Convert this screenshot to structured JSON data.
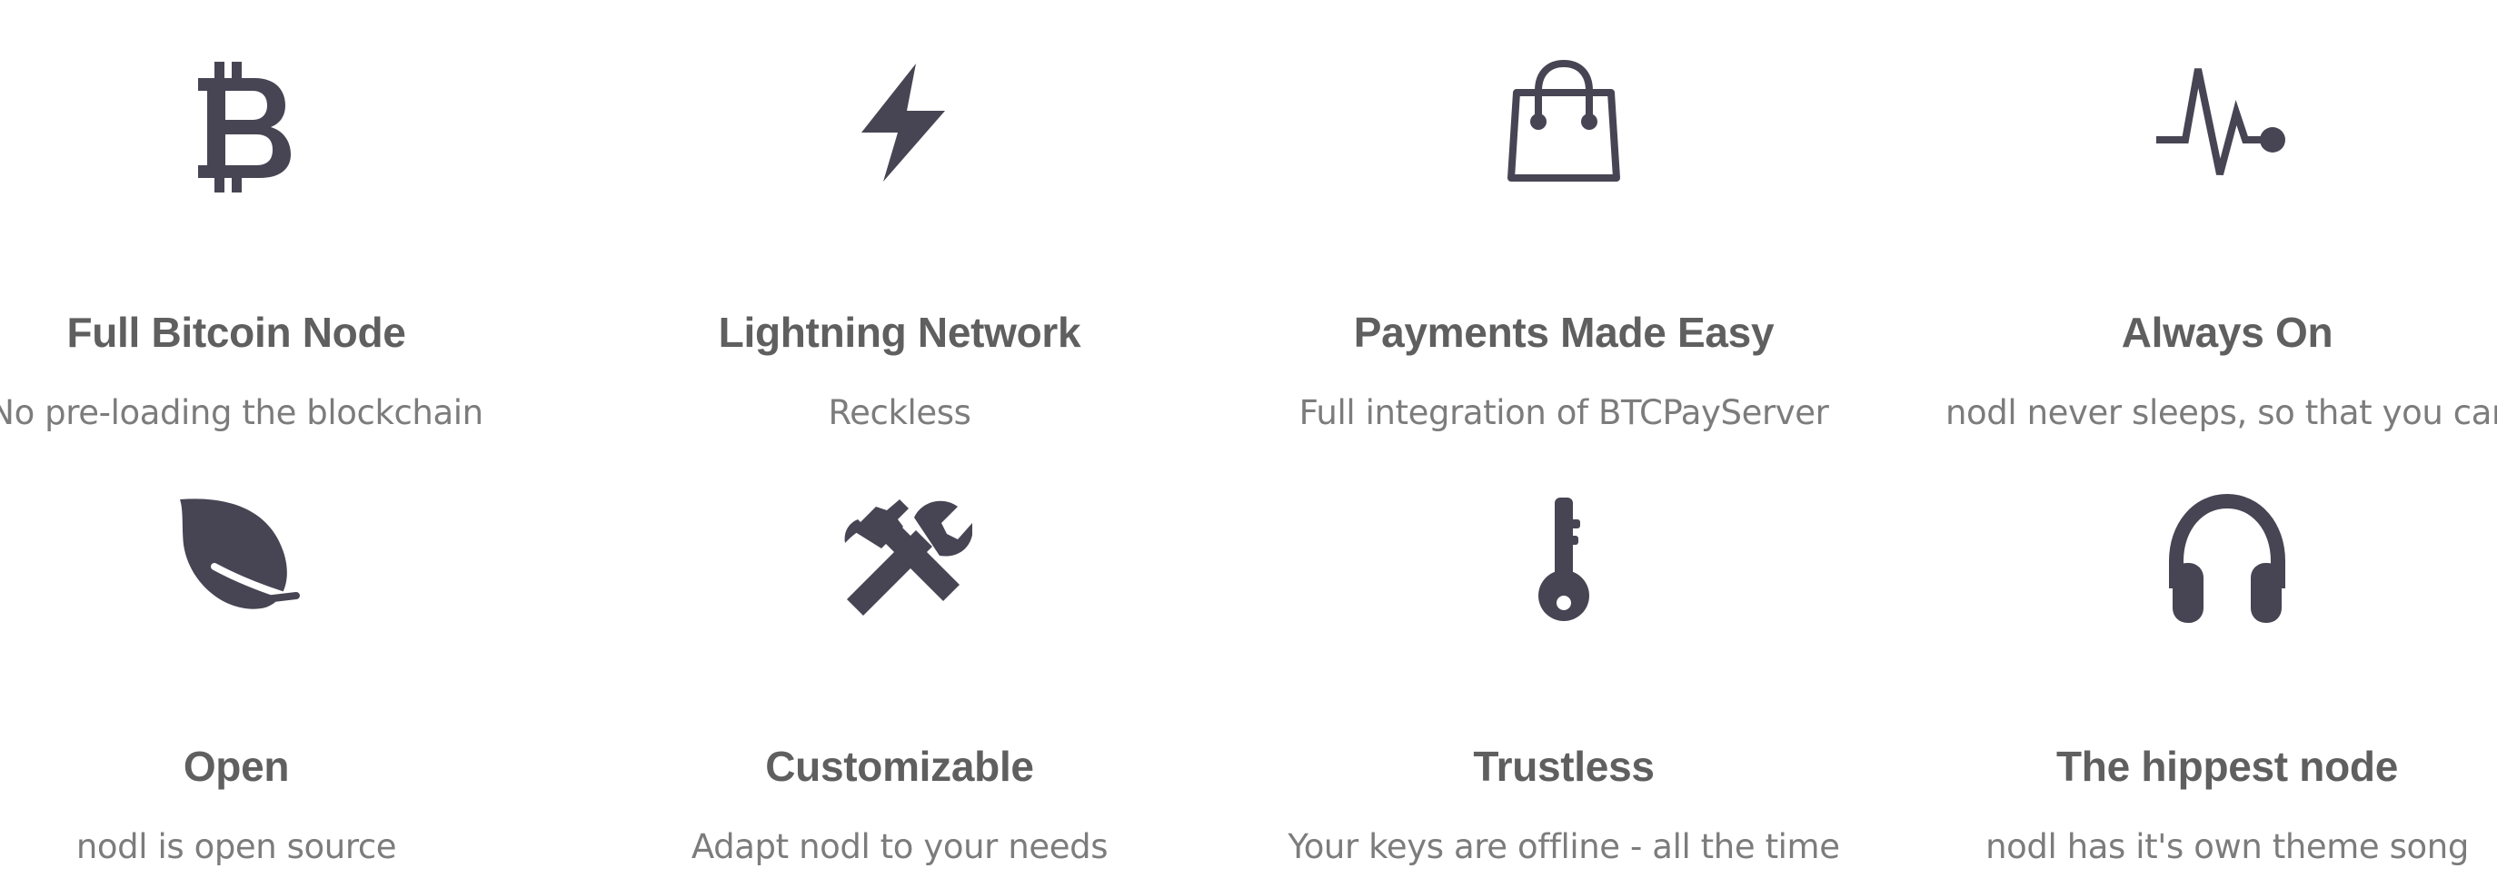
{
  "colors": {
    "icon": "#474553",
    "title": "#5f5f5f",
    "subtitle": "#7c7c7c",
    "background": "#ffffff"
  },
  "features": [
    {
      "icon": "bitcoin-icon",
      "title": "Full Bitcoin Node",
      "subtitle": "No pre-loading the blockchain"
    },
    {
      "icon": "lightning-icon",
      "title": "Lightning Network",
      "subtitle": "Reckless"
    },
    {
      "icon": "shopping-bag-icon",
      "title": "Payments Made Easy",
      "subtitle": "Full integration of BTCPayServer"
    },
    {
      "icon": "heartbeat-icon",
      "title": "Always On",
      "subtitle": "nodl never sleeps, so that you can"
    },
    {
      "icon": "leaf-icon",
      "title": "Open",
      "subtitle": "nodl is open source"
    },
    {
      "icon": "tools-icon",
      "title": "Customizable",
      "subtitle": "Adapt nodl to your needs"
    },
    {
      "icon": "key-icon",
      "title": "Trustless",
      "subtitle": "Your keys are offline - all the time"
    },
    {
      "icon": "headphones-icon",
      "title": "The hippest node",
      "subtitle": "nodl has it's own theme song"
    }
  ]
}
